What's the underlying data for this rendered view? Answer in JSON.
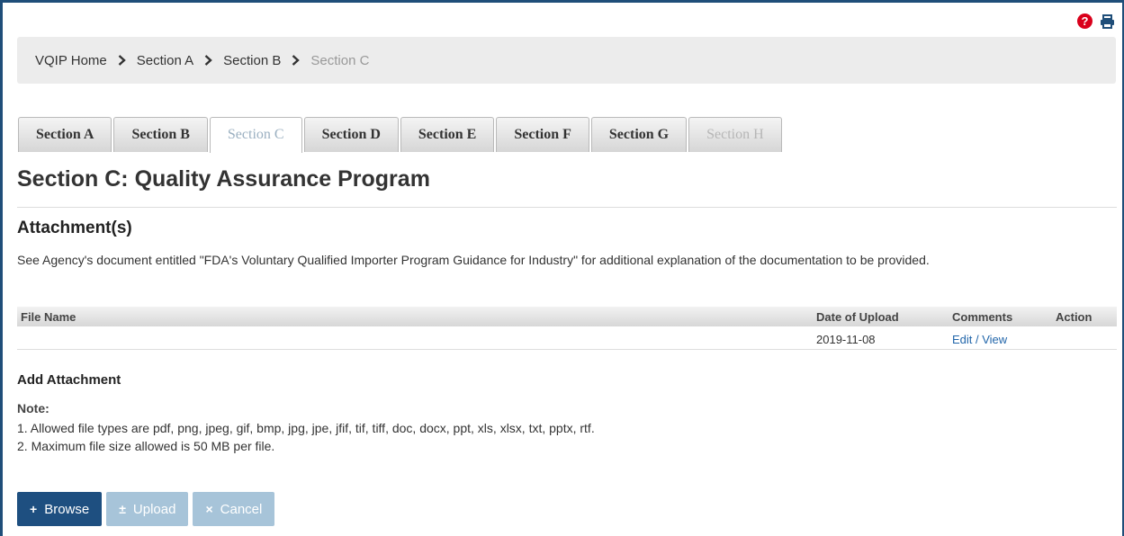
{
  "icons": {
    "help": "?",
    "print": "printer-icon"
  },
  "breadcrumb": {
    "items": [
      "VQIP Home",
      "Section A",
      "Section B"
    ],
    "current": "Section C"
  },
  "tabs": [
    "Section A",
    "Section B",
    "Section C",
    "Section D",
    "Section E",
    "Section F",
    "Section G",
    "Section H"
  ],
  "active_tab": "Section C",
  "disabled_tab": "Section H",
  "page_title": "Section C: Quality Assurance Program",
  "attachments": {
    "heading": "Attachment(s)",
    "description": "See Agency's document entitled \"FDA's Voluntary Qualified Importer Program Guidance for Industry\" for additional explanation of the documentation to be provided.",
    "columns": {
      "file_name": "File Name",
      "date": "Date of Upload",
      "comments": "Comments",
      "action": "Action"
    },
    "rows": [
      {
        "file_name": "",
        "date": "2019-11-08",
        "comments": "Edit / View",
        "action": ""
      }
    ]
  },
  "add_attachment": {
    "heading": "Add Attachment",
    "note_label": "Note:",
    "note_lines": [
      "1. Allowed file types are pdf, png, jpeg, gif, bmp, jpg, jpe, jfif, tif, tiff, doc, docx, ppt, xls, xlsx, txt, pptx, rtf.",
      "2. Maximum file size allowed is 50 MB per file."
    ]
  },
  "buttons": {
    "browse": {
      "icon": "+",
      "label": "Browse"
    },
    "upload": {
      "icon": "±",
      "label": "Upload"
    },
    "cancel": {
      "icon": "×",
      "label": "Cancel"
    }
  },
  "colors": {
    "primary": "#1e4f80",
    "disabled": "#a7c4d9",
    "help": "#d9001b",
    "link": "#2266aa"
  }
}
